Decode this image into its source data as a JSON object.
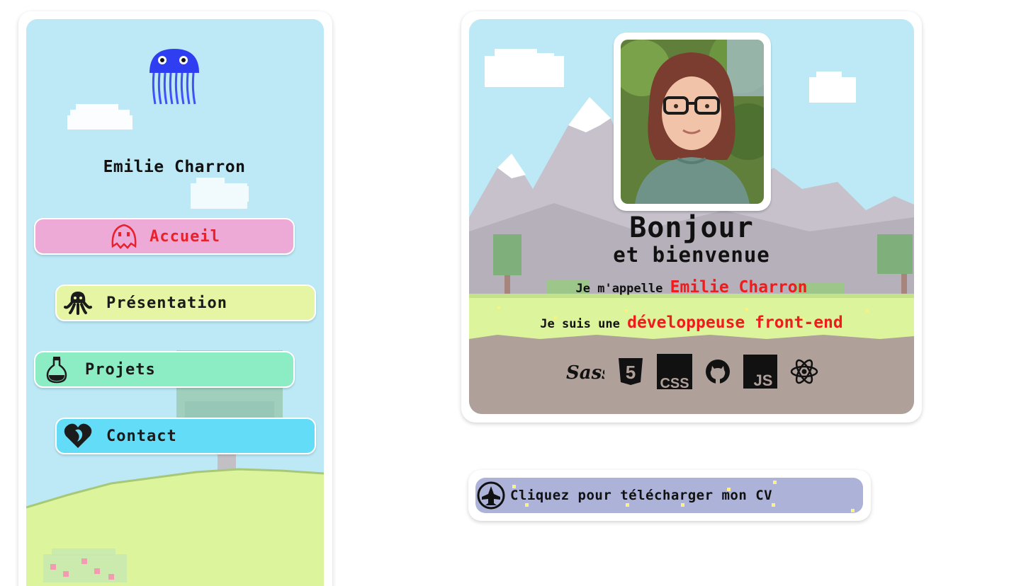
{
  "sidebar": {
    "name": "Emilie Charron",
    "nav": [
      {
        "label": "Accueil",
        "icon": "ghost-icon",
        "color": "#eeaad7",
        "active": true
      },
      {
        "label": "Présentation",
        "icon": "octopus-icon",
        "color": "#e6f5a3"
      },
      {
        "label": "Projets",
        "icon": "flask-icon",
        "color": "#8cedc5"
      },
      {
        "label": "Contact",
        "icon": "heart-icon",
        "color": "#63dcf8"
      }
    ],
    "logo": "jellyfish-logo"
  },
  "hero": {
    "title": "Bonjour",
    "subtitle": "et bienvenue",
    "intro_prefix": "Je m'appelle",
    "intro_name": "Emilie Charron",
    "role_prefix": "Je suis une",
    "role_highlight": "développeuse front-end",
    "photo": "profile-photo",
    "skills": [
      {
        "icon": "sass-icon",
        "text": "Sass"
      },
      {
        "icon": "html5-icon",
        "text": "5"
      },
      {
        "icon": "css-icon",
        "text": "CSS"
      },
      {
        "icon": "github-icon"
      },
      {
        "icon": "javascript-icon",
        "text": "JS"
      },
      {
        "icon": "react-icon"
      }
    ]
  },
  "cv": {
    "label": "Cliquez pour télécharger mon CV",
    "icon": "spaceship-icon"
  },
  "colors": {
    "accent_red": "#ee1c1c",
    "sky": "#bde9f7",
    "grass": "#dcf59c",
    "ground": "#b0a09a",
    "cv_button": "#adb2d8"
  }
}
